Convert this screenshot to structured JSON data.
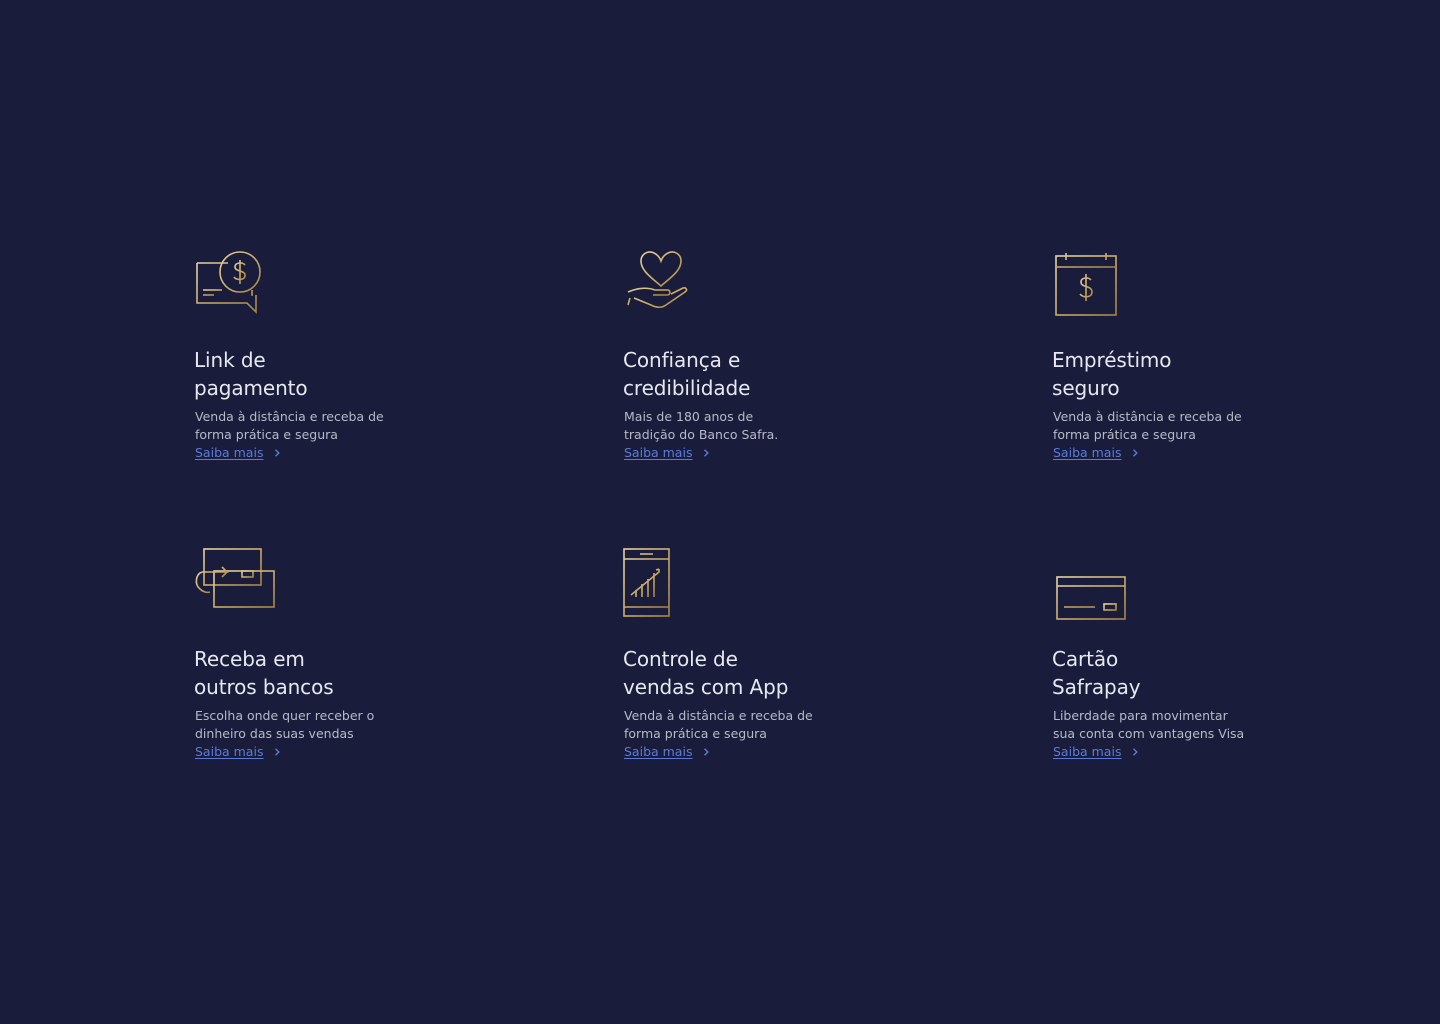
{
  "colors": {
    "background": "#191d3b",
    "title": "#e7e8ef",
    "text": "#b7bac8",
    "link": "#5b7bd8",
    "icon_gold": "#c9a966"
  },
  "features": [
    {
      "icon": "payment-link-icon",
      "title_line1": "Link de",
      "title_line2": "pagamento",
      "desc_line1": "Venda à distância e receba de",
      "desc_line2": "forma prática e segura",
      "link": "Saiba mais"
    },
    {
      "icon": "heart-hand-icon",
      "title_line1": "Confiança e",
      "title_line2": "credibilidade",
      "desc_line1": "Mais de 180 anos de",
      "desc_line2": "tradição do Banco Safra.",
      "link": "Saiba mais"
    },
    {
      "icon": "calendar-dollar-icon",
      "title_line1": "Empréstimo",
      "title_line2": "seguro",
      "desc_line1": "Venda à distância e receba de",
      "desc_line2": "forma prática e segura",
      "link": "Saiba mais"
    },
    {
      "icon": "card-transfer-icon",
      "title_line1": "Receba em",
      "title_line2": "outros bancos",
      "desc_line1": "Escolha onde quer receber o",
      "desc_line2": "dinheiro das suas vendas",
      "link": "Saiba mais"
    },
    {
      "icon": "phone-chart-icon",
      "title_line1": "Controle de",
      "title_line2": "vendas com App",
      "desc_line1": "Venda à distância e receba de",
      "desc_line2": "forma prática e segura",
      "link": "Saiba mais"
    },
    {
      "icon": "credit-card-icon",
      "title_line1": "Cartão",
      "title_line2": "Safrapay",
      "desc_line1": "Liberdade para movimentar",
      "desc_line2": "sua conta com vantagens Visa",
      "link": "Saiba mais"
    }
  ]
}
